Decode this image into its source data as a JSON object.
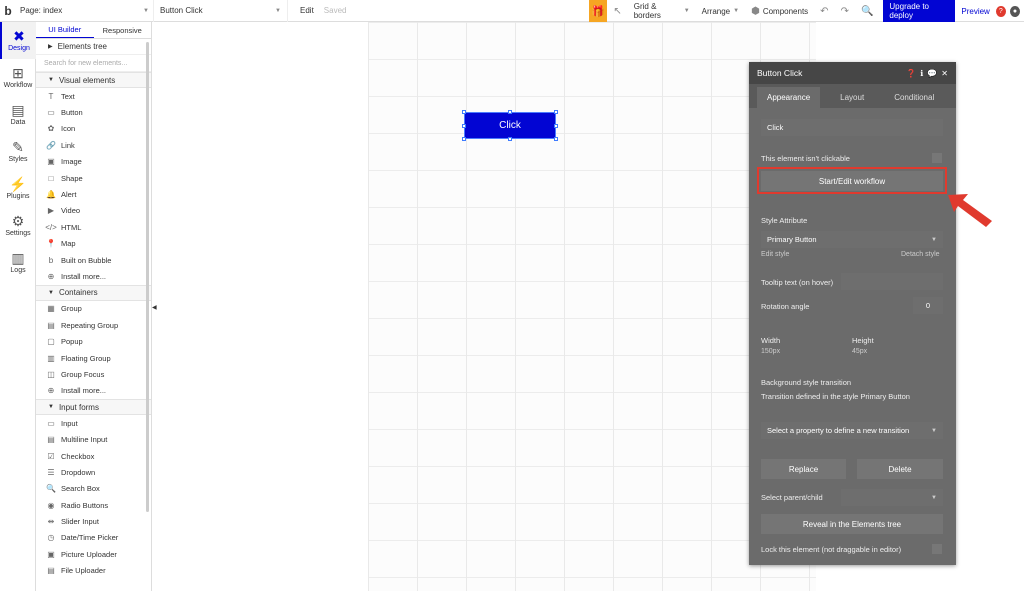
{
  "topbar": {
    "logo": "b",
    "page_label": "Page: index",
    "element_select": "Button Click",
    "edit_label": "Edit",
    "saved_label": "Saved",
    "grid_borders": "Grid & borders",
    "arrange": "Arrange",
    "components": "Components",
    "upgrade": "Upgrade to deploy",
    "preview": "Preview"
  },
  "rail": {
    "items": [
      {
        "label": "Design"
      },
      {
        "label": "Workflow"
      },
      {
        "label": "Data"
      },
      {
        "label": "Styles"
      },
      {
        "label": "Plugins"
      },
      {
        "label": "Settings"
      },
      {
        "label": "Logs"
      }
    ]
  },
  "panel": {
    "tab_builder": "UI Builder",
    "tab_responsive": "Responsive",
    "elements_tree": "Elements tree",
    "search_placeholder": "Search for new elements...",
    "visual_head": "Visual elements",
    "visual": [
      "Text",
      "Button",
      "Icon",
      "Link",
      "Image",
      "Shape",
      "Alert",
      "Video",
      "HTML",
      "Map",
      "Built on Bubble",
      "Install more..."
    ],
    "containers_head": "Containers",
    "containers": [
      "Group",
      "Repeating Group",
      "Popup",
      "Floating Group",
      "Group Focus",
      "Install more..."
    ],
    "inputs_head": "Input forms",
    "inputs": [
      "Input",
      "Multiline Input",
      "Checkbox",
      "Dropdown",
      "Search Box",
      "Radio Buttons",
      "Slider Input",
      "Date/Time Picker",
      "Picture Uploader",
      "File Uploader"
    ]
  },
  "canvas": {
    "button_label": "Click"
  },
  "editor": {
    "title": "Button Click",
    "tab_appearance": "Appearance",
    "tab_layout": "Layout",
    "tab_conditional": "Conditional",
    "text_value": "Click",
    "not_clickable": "This element isn't clickable",
    "workflow_btn": "Start/Edit workflow",
    "style_attr": "Style Attribute",
    "style_value": "Primary Button",
    "edit_style": "Edit style",
    "detach_style": "Detach style",
    "tooltip": "Tooltip text (on hover)",
    "rotation": "Rotation angle",
    "rotation_value": "0",
    "width_label": "Width",
    "width_value": "150px",
    "height_label": "Height",
    "height_value": "45px",
    "bg_transition": "Background style transition",
    "transition_defined": "Transition defined in the style Primary Button",
    "transition_select": "Select a property to define a new transition",
    "replace": "Replace",
    "delete": "Delete",
    "parent_child": "Select parent/child",
    "reveal": "Reveal in the Elements tree",
    "lock": "Lock this element (not draggable in editor)"
  },
  "colors": {
    "brand_blue": "#0205d3",
    "highlight_red": "#e03a2e",
    "gift_orange": "#f6a623"
  }
}
